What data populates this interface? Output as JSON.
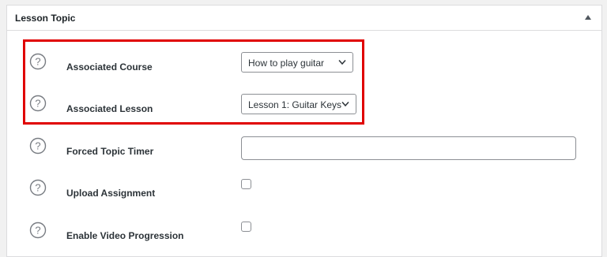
{
  "panel": {
    "title": "Lesson Topic",
    "toggle_icon": "triangle-up-icon"
  },
  "fields": {
    "associated_course": {
      "label": "Associated Course",
      "value": "How to play guitar"
    },
    "associated_lesson": {
      "label": "Associated Lesson",
      "value": "Lesson 1: Guitar Keys"
    },
    "forced_topic_timer": {
      "label": "Forced Topic Timer",
      "value": ""
    },
    "upload_assignment": {
      "label": "Upload Assignment",
      "checked": false
    },
    "enable_video_progression": {
      "label": "Enable Video Progression",
      "checked": false
    }
  },
  "icons": {
    "help": "question-circle-icon",
    "dropdown": "chevron-down-icon"
  },
  "colors": {
    "highlight": "#e00000",
    "border": "#dcdcde",
    "text": "#1d2327"
  }
}
